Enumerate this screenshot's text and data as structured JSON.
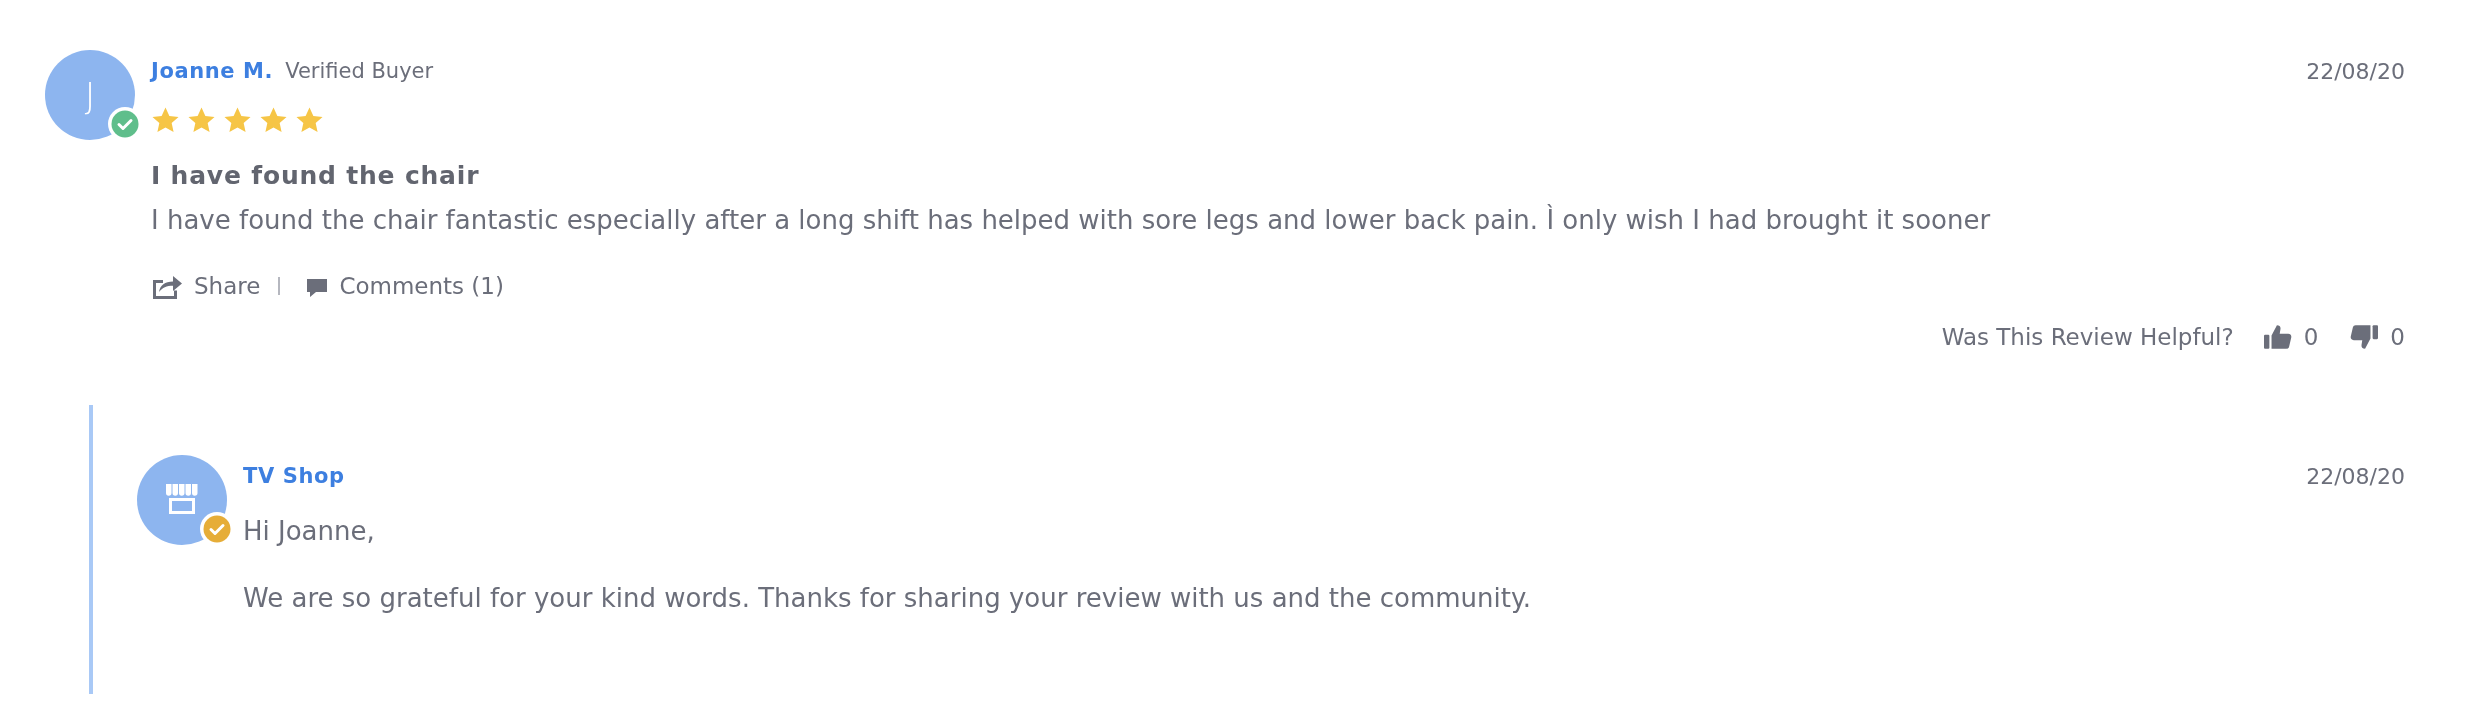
{
  "review": {
    "author": {
      "kind": "buyer",
      "initial": "J",
      "name": "Joanne M.",
      "label": "Verified Buyer",
      "verified": true
    },
    "date": "22/08/20",
    "stars": 5,
    "title": "I have found the chair",
    "body": "I have found the chair fantastic especially after a long shift has helped with sore legs and lower back pain. Ì only wish I had brought it sooner",
    "actions": [
      {
        "kind": "share",
        "label": "Share"
      },
      {
        "kind": "comments",
        "label": "Comments (1)"
      }
    ],
    "helpful": {
      "question": "Was This Review Helpful?",
      "votes": [
        {
          "kind": "up",
          "count": "0"
        },
        {
          "kind": "down",
          "count": "0"
        }
      ]
    }
  },
  "reply": {
    "author": {
      "kind": "shop",
      "name": "TV Shop",
      "verified": true
    },
    "date": "22/08/20",
    "paragraphs": [
      "Hi Joanne,",
      "We are so grateful for your kind words. Thanks for sharing your review with us and the community."
    ]
  }
}
